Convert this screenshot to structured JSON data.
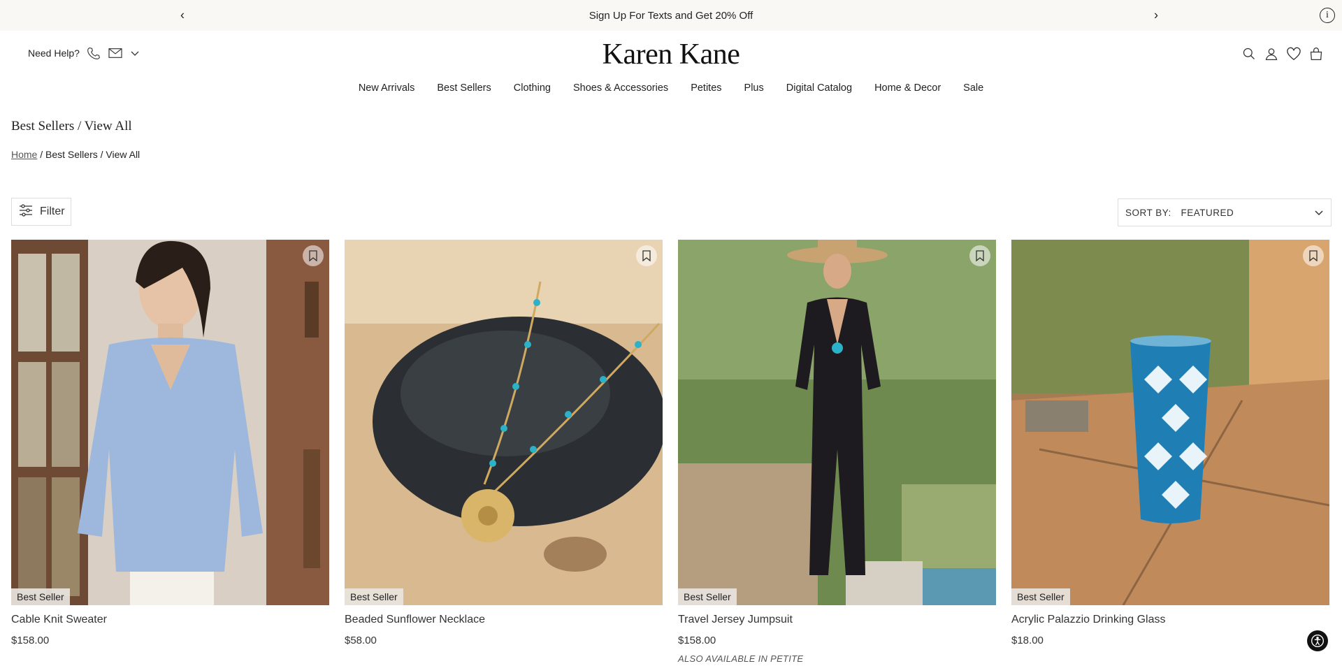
{
  "announcement": {
    "message": "Sign Up For Texts and Get 20% Off",
    "prev": "‹",
    "next": "›",
    "info": "i"
  },
  "header": {
    "help_label": "Need Help?",
    "logo": "Karen Kane"
  },
  "nav": {
    "items": [
      "New Arrivals",
      "Best Sellers",
      "Clothing",
      "Shoes & Accessories",
      "Petites",
      "Plus",
      "Digital Catalog",
      "Home & Decor",
      "Sale"
    ]
  },
  "page": {
    "title": "Best Sellers / View All",
    "breadcrumb_home": "Home",
    "breadcrumb_rest": " / Best Sellers / View All"
  },
  "toolbar": {
    "filter_label": "Filter",
    "sort_label": "SORT BY:",
    "sort_value": "FEATURED"
  },
  "products": [
    {
      "name": "Cable Knit Sweater",
      "price": "$158.00",
      "badge": "Best Seller",
      "also": ""
    },
    {
      "name": "Beaded Sunflower Necklace",
      "price": "$58.00",
      "badge": "Best Seller",
      "also": ""
    },
    {
      "name": "Travel Jersey Jumpsuit",
      "price": "$158.00",
      "badge": "Best Seller",
      "also": "ALSO AVAILABLE IN PETITE"
    },
    {
      "name": "Acrylic Palazzio Drinking Glass",
      "price": "$18.00",
      "badge": "Best Seller",
      "also": ""
    }
  ],
  "colors": {
    "announce_bg": "#faf8f5",
    "text": "#222222",
    "badge_bg": "#e8e4de"
  }
}
